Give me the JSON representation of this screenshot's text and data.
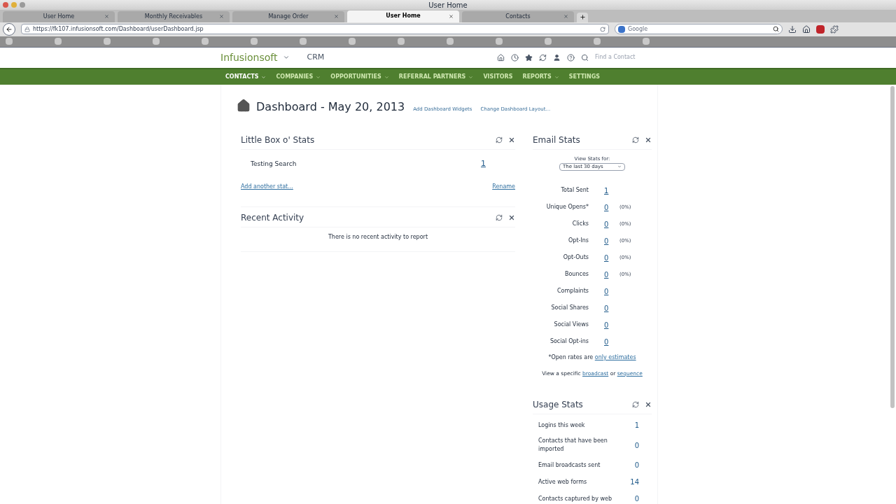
{
  "window": {
    "title": "User Home"
  },
  "tabs": [
    {
      "label": "User Home",
      "selected": false
    },
    {
      "label": "Monthly Receivables",
      "selected": false
    },
    {
      "label": "Manage Order",
      "selected": false
    },
    {
      "label": "User Home",
      "selected": true
    },
    {
      "label": "Contacts",
      "selected": false
    }
  ],
  "address_bar": {
    "url": "https://fk107.infusionsoft.com/Dashboard/userDashboard.jsp"
  },
  "search_bar": {
    "placeholder": "Google"
  },
  "app_header": {
    "logo": "Infusionsoft",
    "section": "CRM",
    "search_placeholder": "Find a Contact"
  },
  "nav": [
    {
      "label": "CONTACTS",
      "dropdown": true,
      "selected": true
    },
    {
      "label": "COMPANIES",
      "dropdown": true,
      "selected": false
    },
    {
      "label": "OPPORTUNITIES",
      "dropdown": true,
      "selected": false
    },
    {
      "label": "REFERRAL PARTNERS",
      "dropdown": true,
      "selected": false
    },
    {
      "label": "VISITORS",
      "dropdown": false,
      "selected": false
    },
    {
      "label": "REPORTS",
      "dropdown": true,
      "selected": false
    },
    {
      "label": "SETTINGS",
      "dropdown": false,
      "selected": false
    }
  ],
  "page": {
    "title": "Dashboard - May 20, 2013",
    "links": [
      "Add Dashboard Widgets",
      "Change Dashboard Layout..."
    ]
  },
  "little_box": {
    "title": "Little Box o' Stats",
    "rows": [
      {
        "label": "Testing Search",
        "value": "1"
      }
    ],
    "add_link": "Add another stat...",
    "rename_link": "Rename"
  },
  "recent_activity": {
    "title": "Recent Activity",
    "message": "There is no recent activity to report"
  },
  "email_stats": {
    "title": "Email Stats",
    "view_label": "View Stats for:",
    "period": "The last 30 days",
    "rows": [
      {
        "label": "Total Sent",
        "value": "1"
      },
      {
        "label": "Unique Opens*",
        "value": "0",
        "percent": "(0%)"
      },
      {
        "label": "Clicks",
        "value": "0",
        "percent": "(0%)"
      },
      {
        "label": "Opt-Ins",
        "value": "0",
        "percent": "(0%)"
      },
      {
        "label": "Opt-Outs",
        "value": "0",
        "percent": "(0%)"
      },
      {
        "label": "Bounces",
        "value": "0",
        "percent": "(0%)"
      },
      {
        "label": "Complaints",
        "value": "0"
      },
      {
        "label": "Social Shares",
        "value": "0"
      },
      {
        "label": "Social Views",
        "value": "0"
      },
      {
        "label": "Social Opt-ins",
        "value": "0"
      }
    ],
    "note": "*Open rates are",
    "note_link": "only estimates",
    "view_text": "View a specific",
    "link_1": "broadcast",
    "or": "or",
    "link_2": "sequence"
  },
  "usage_stats": {
    "title": "Usage Stats",
    "rows": [
      {
        "label": "Logins this week",
        "value": "1"
      },
      {
        "label": "Contacts that have been imported",
        "value": "0"
      },
      {
        "label": "Email broadcasts sent",
        "value": "0"
      },
      {
        "label": "Active web forms",
        "value": "14"
      },
      {
        "label": "Contacts captured by web",
        "value": "0"
      }
    ]
  }
}
